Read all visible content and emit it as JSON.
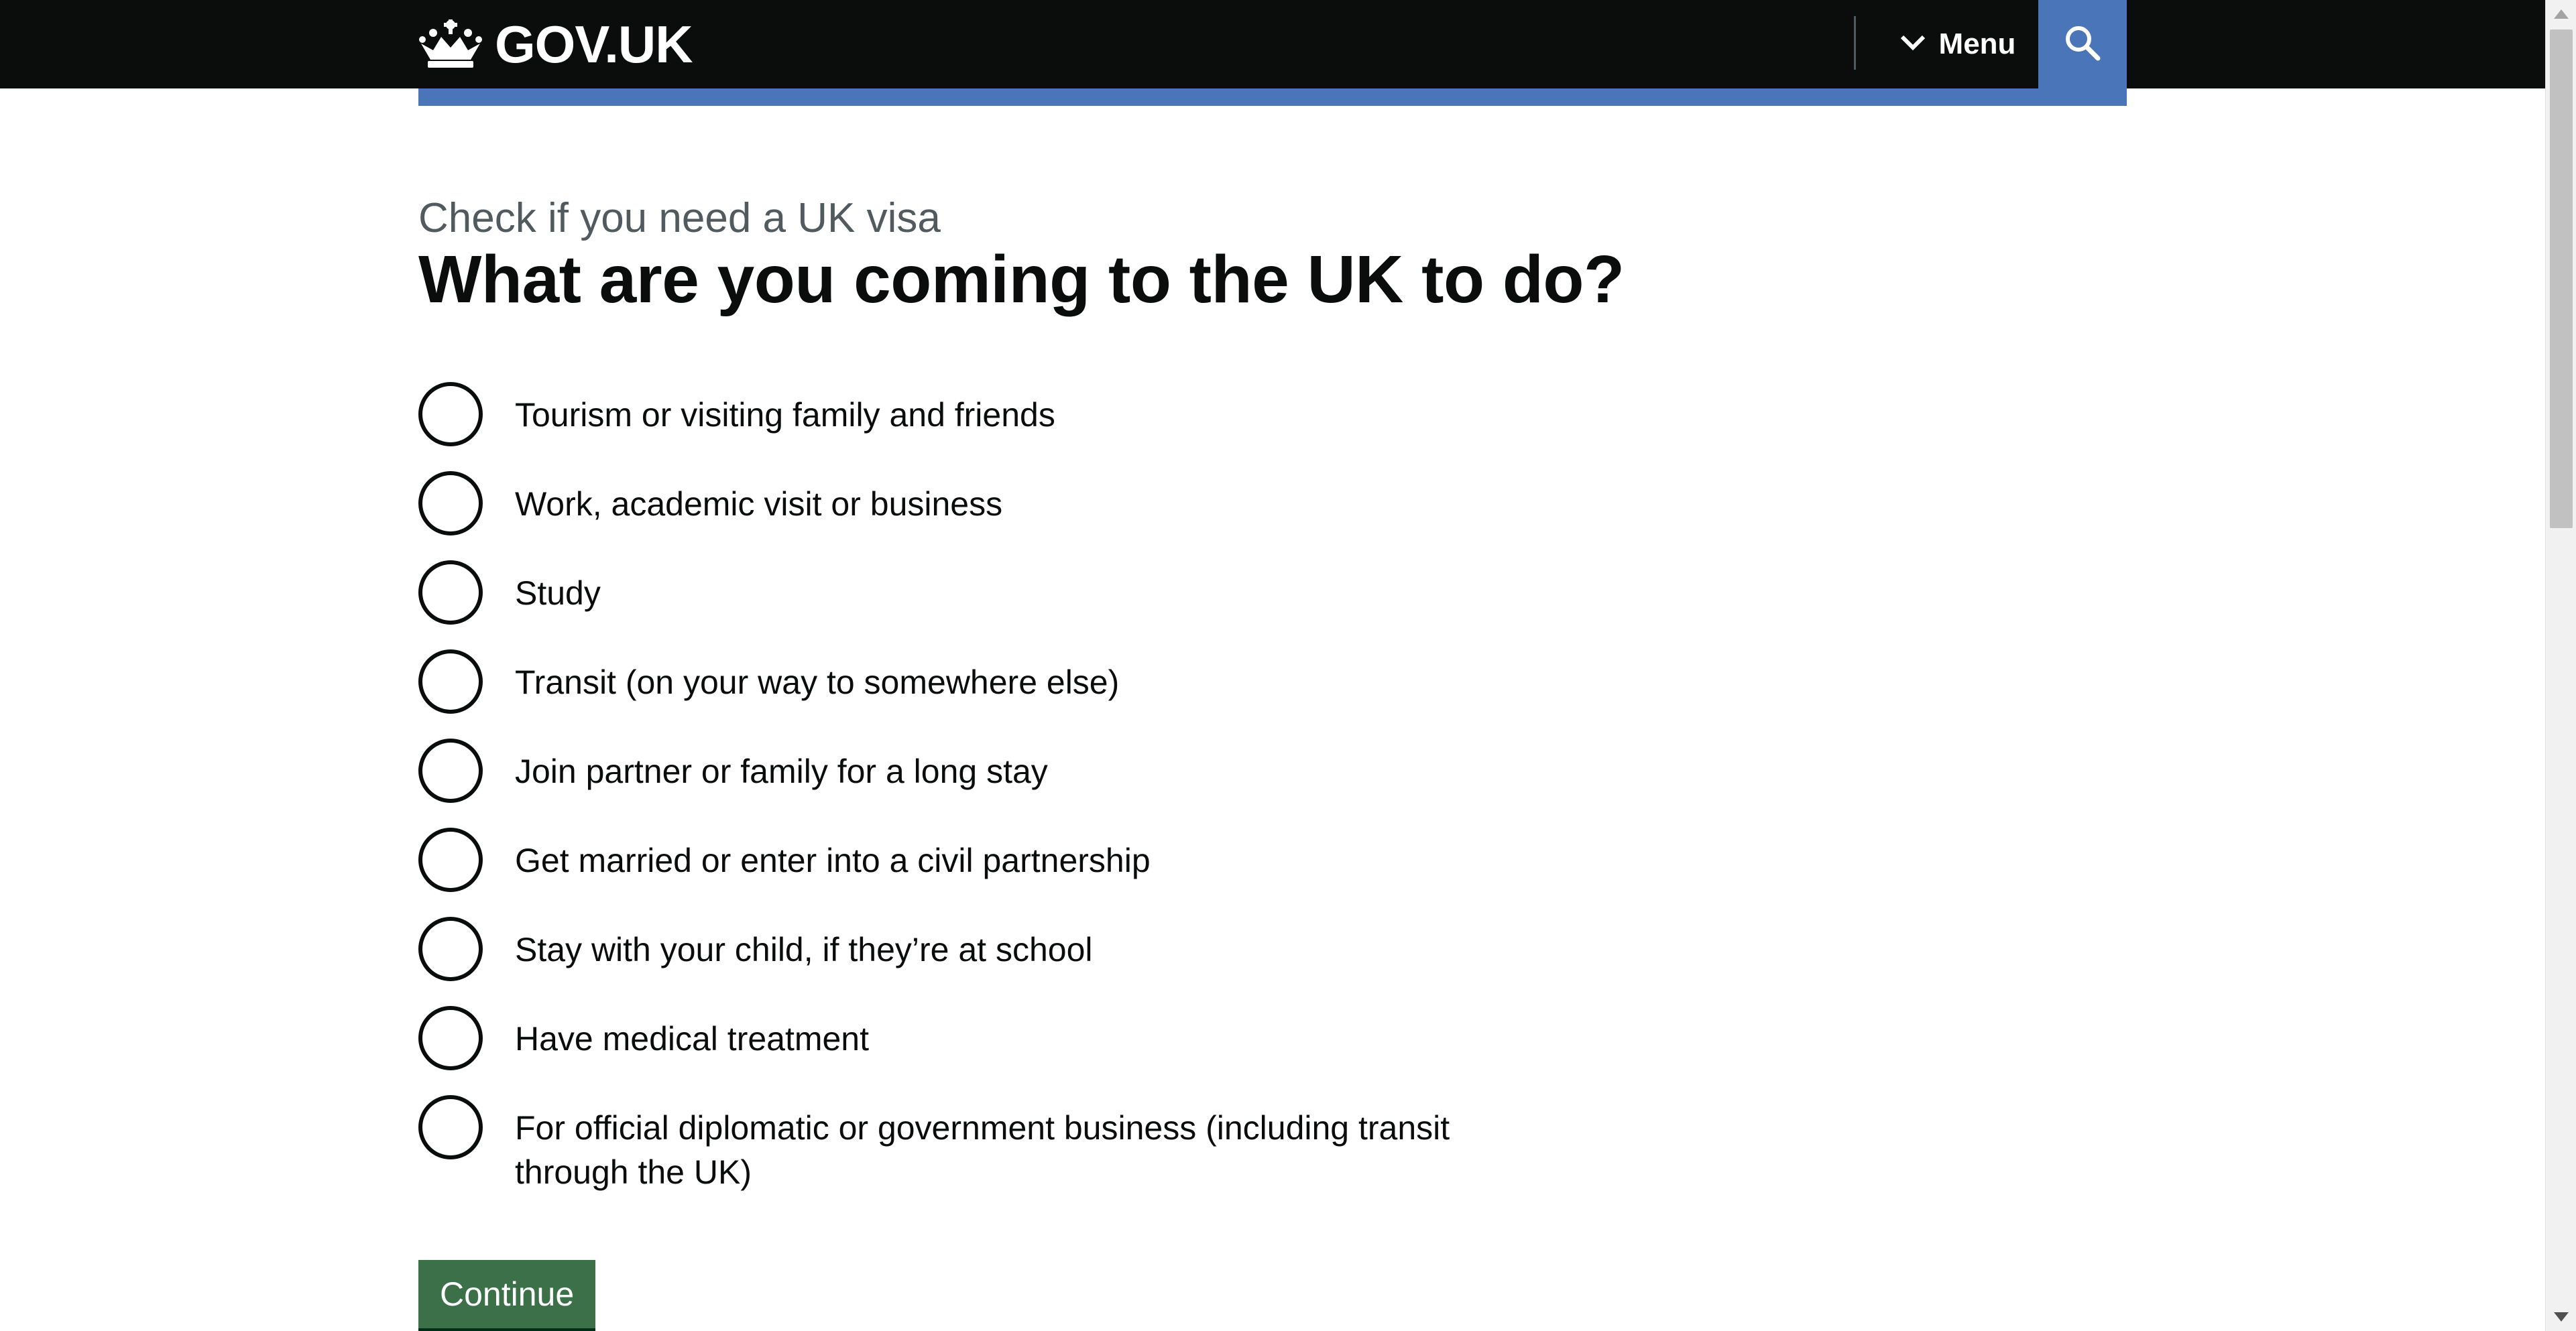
{
  "header": {
    "logo_text": "GOV.UK",
    "menu_label": "Menu",
    "search_icon": "search-icon",
    "menu_icon": "chevron-down-icon",
    "logo_icon": "crown-icon"
  },
  "main": {
    "caption": "Check if you need a UK visa",
    "heading": "What are you coming to the UK to do?",
    "options": [
      "Tourism or visiting family and friends",
      "Work, academic visit or business",
      "Study",
      "Transit (on your way to somewhere else)",
      "Join partner or family for a long stay",
      "Get married or enter into a civil partnership",
      "Stay with your child, if they’re at school",
      "Have medical treatment",
      "For official diplomatic or government business (including transit through the UK)"
    ],
    "continue_label": "Continue"
  },
  "colors": {
    "header_bg": "#0b0c0c",
    "accent_blue": "#4a75b8",
    "button_green": "#3c7049",
    "caption_grey": "#505a5f"
  }
}
